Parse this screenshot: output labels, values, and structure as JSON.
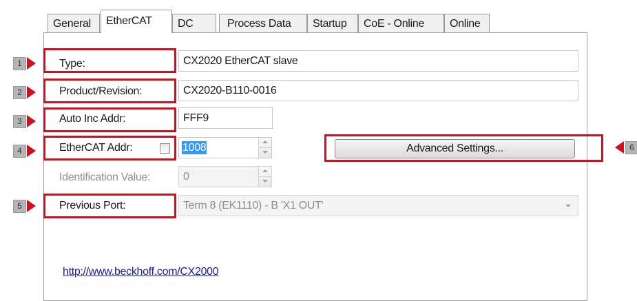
{
  "tabs": [
    {
      "label": "General"
    },
    {
      "label": "EtherCAT"
    },
    {
      "label": "DC"
    },
    {
      "label": "Process Data"
    },
    {
      "label": "Startup"
    },
    {
      "label": "CoE - Online"
    },
    {
      "label": "Online"
    }
  ],
  "active_tab": "EtherCAT",
  "form": {
    "type_label": "Type:",
    "type_value": "CX2020 EtherCAT slave",
    "product_label": "Product/Revision:",
    "product_value": "CX2020-B110-0016",
    "autoinc_label": "Auto Inc Addr:",
    "autoinc_value": "FFF9",
    "ethercat_addr_label": "EtherCAT Addr:",
    "ethercat_addr_value": "1008",
    "ethercat_addr_checked": false,
    "ident_label": "Identification Value:",
    "ident_value": "0",
    "prev_port_label": "Previous Port:",
    "prev_port_value": "Term 8 (EK1110) - B 'X1 OUT'",
    "advanced_button": "Advanced Settings...",
    "link": "http://www.beckhoff.com/CX2000"
  },
  "callouts": [
    "1",
    "2",
    "3",
    "4",
    "5",
    "6"
  ],
  "colors": {
    "highlight": "#d0101e",
    "selection": "#3399ff",
    "link": "#1a1aa8"
  }
}
